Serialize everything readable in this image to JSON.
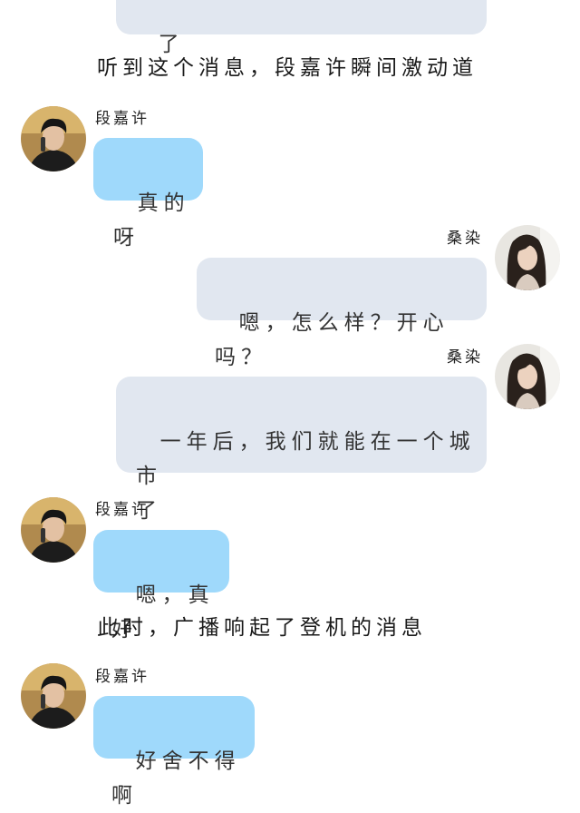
{
  "colors": {
    "left_bubble": "#9fd9fb",
    "right_bubble": "#e1e7f0",
    "background": "#ffffff"
  },
  "top_bubble": {
    "text": "了"
  },
  "narrations": [
    "听到这个消息，段嘉许瞬间激动道",
    "此时，广播响起了登机的消息"
  ],
  "messages": [
    {
      "sender": "段嘉许",
      "text": "真的呀",
      "avatar": "male-avatar"
    },
    {
      "sender": "桑染",
      "text": "嗯，怎么样？开心吗？",
      "avatar": "female-avatar"
    },
    {
      "sender": "桑染",
      "text": "一年后，我们就能在一个城市\n了",
      "avatar": "female-avatar"
    },
    {
      "sender": "段嘉许",
      "text": "嗯，真好",
      "avatar": "male-avatar"
    },
    {
      "sender": "段嘉许",
      "text": "好舍不得啊",
      "avatar": "male-avatar"
    }
  ]
}
